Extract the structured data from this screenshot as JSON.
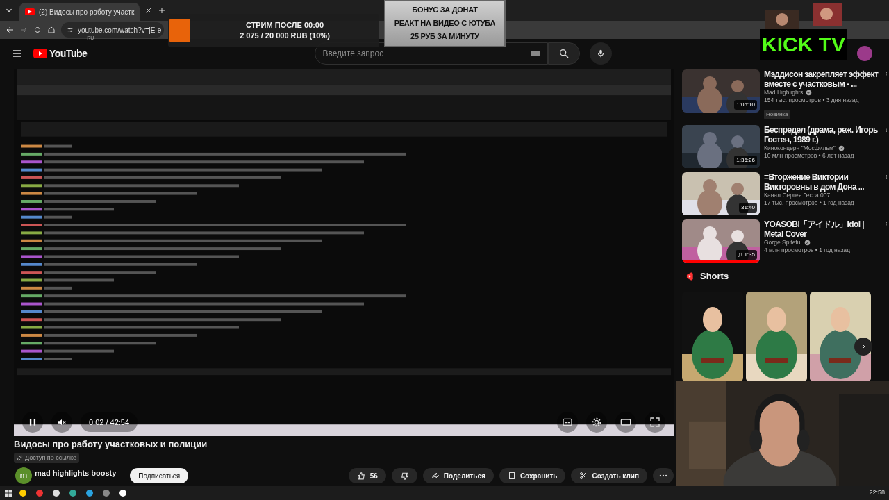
{
  "browser": {
    "tab_title": "(2) Видосы про работу участк",
    "url": "youtube.com/watch?v=jE-e"
  },
  "stream_overlay": {
    "goal_title": "СТРИМ ПОСЛЕ 00:00",
    "goal_amount": "2 075 / 20 000 RUB (10%)",
    "plate_lines": [
      "БОНУС ЗА ДОНАТ",
      "РЕАКТ НА ВИДЕО С ЮТУБА",
      "25 РУБ ЗА МИНУТУ"
    ],
    "logo": "KICK TV"
  },
  "header": {
    "logo": "YouTube",
    "region": "RU",
    "search": {
      "placeholder": "Введите запрос"
    }
  },
  "player": {
    "time": "0:02 / 42:54",
    "paused": false,
    "muted": true
  },
  "video": {
    "title": "Видосы про работу участковых и полиции",
    "access": "Доступ по ссылке",
    "channel_initial": "m",
    "channel": "mad highlights boosty",
    "subscribe": "Подписаться",
    "likes": "56",
    "actions": [
      "Поделиться",
      "Сохранить",
      "Создать клип"
    ]
  },
  "recommendations": [
    {
      "title": "Мэддисон закрепляет эффект вместе с участковым - ...",
      "channel": "Mad Highlights",
      "verified": true,
      "meta": "154 тыс. просмотров • 3 дня назад",
      "badge": "Новинка",
      "duration": "1:05:10",
      "kind": "video"
    },
    {
      "title": "Беспредел (драма, реж. Игорь Гостев, 1989 г.)",
      "channel": "Киноконцерн \"Мосфильм\"",
      "verified": true,
      "meta": "10 млн просмотров • 6 лет назад",
      "duration": "1:36:26",
      "kind": "video"
    },
    {
      "title": "=Вторжение Виктории Викторовны в дом Дона ...",
      "channel": "Канал Сергея Гесса 007",
      "verified": false,
      "meta": "17 тыс. просмотров • 1 год назад",
      "duration": "31:40",
      "kind": "video"
    },
    {
      "title": "YOASOBI「アイドル」Idol | Metal Cover",
      "channel": "Gorge Spiteful",
      "verified": true,
      "meta": "4 млн просмотров • 1 год назад",
      "duration": "1:35",
      "kind": "music",
      "level": 1
    }
  ],
  "shorts": {
    "title": "Shorts"
  },
  "taskbar": {
    "time": "22:58"
  }
}
